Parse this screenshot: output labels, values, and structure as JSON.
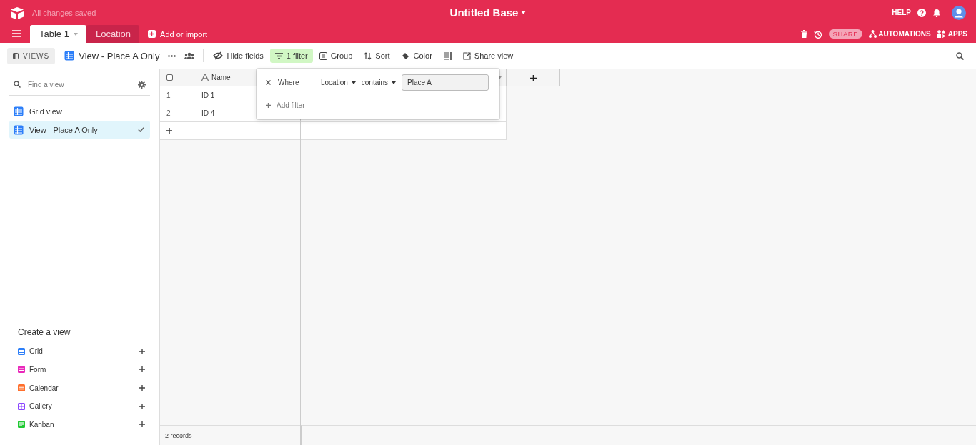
{
  "header": {
    "save_status": "All changes saved",
    "base_title": "Untitled Base",
    "help": "HELP"
  },
  "tabs": [
    {
      "label": "Table 1",
      "selected": true
    },
    {
      "label": "Location",
      "selected": false
    }
  ],
  "add_table": "Add or import",
  "header_actions": {
    "share": "SHARE",
    "automations": "AUTOMATIONS",
    "apps": "APPS"
  },
  "toolbar": {
    "views_button": "VIEWS",
    "current_view": "View - Place A Only",
    "items": [
      {
        "label": "Hide fields",
        "kind": "hide",
        "active": false
      },
      {
        "label": "1 filter",
        "kind": "filter",
        "active": true
      },
      {
        "label": "Group",
        "kind": "group",
        "active": false
      },
      {
        "label": "Sort",
        "kind": "sort",
        "active": false
      },
      {
        "label": "Color",
        "kind": "color",
        "active": false
      },
      {
        "kind": "height",
        "active": false
      },
      {
        "label": "Share view",
        "kind": "share",
        "active": false
      }
    ]
  },
  "sidebar": {
    "search": {
      "placeholder": "Find a view"
    },
    "views": [
      {
        "name": "Grid view",
        "selected": false
      },
      {
        "name": "View - Place A Only",
        "selected": true
      }
    ],
    "create_heading": "Create a view",
    "create_options": [
      {
        "label": "Grid",
        "kind": "grid",
        "color": "#2d7ff9"
      },
      {
        "label": "Form",
        "kind": "form",
        "color": "#e929ba"
      },
      {
        "label": "Calendar",
        "kind": "calendar",
        "color": "#ff6f2c"
      },
      {
        "label": "Gallery",
        "kind": "gallery",
        "color": "#8b46ff"
      },
      {
        "label": "Kanban",
        "kind": "kanban",
        "color": "#20c933"
      }
    ]
  },
  "grid": {
    "select_all": {
      "checked": false
    },
    "columns": [
      {
        "name": "Name"
      }
    ],
    "rows": [
      {
        "number": "1",
        "name": "ID 1"
      },
      {
        "number": "2",
        "name": "ID 4"
      }
    ],
    "record_count": "2 records"
  },
  "filter_popover": {
    "conditions": [
      {
        "prefix": "Where",
        "field": "Location",
        "operator": "contains",
        "value": "Place A"
      }
    ],
    "add_filter": "Add filter"
  }
}
